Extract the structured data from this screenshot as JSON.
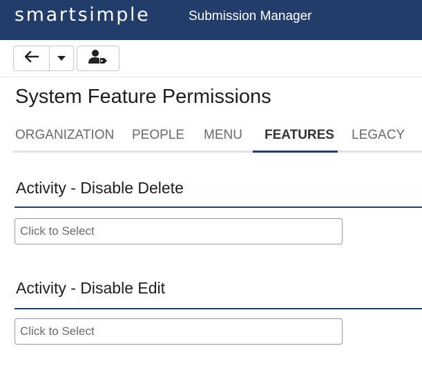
{
  "header": {
    "brand": "smartsimple",
    "app_name": "Submission Manager"
  },
  "toolbar": {
    "back_icon": "arrow-left-icon",
    "dropdown_icon": "caret-down-icon",
    "user_icon": "user-tag-icon"
  },
  "page": {
    "title": "System Feature Permissions"
  },
  "tabs": [
    {
      "label": "ORGANIZATION",
      "active": false
    },
    {
      "label": "PEOPLE",
      "active": false
    },
    {
      "label": "MENU",
      "active": false
    },
    {
      "label": "FEATURES",
      "active": true
    },
    {
      "label": "LEGACY",
      "active": false
    }
  ],
  "sections": [
    {
      "title": "Activity - Disable Delete",
      "select_placeholder": "Click to Select"
    },
    {
      "title": "Activity - Disable Edit",
      "select_placeholder": "Click to Select"
    }
  ],
  "colors": {
    "header_bg": "#233d6b",
    "accent": "#233d6b"
  }
}
